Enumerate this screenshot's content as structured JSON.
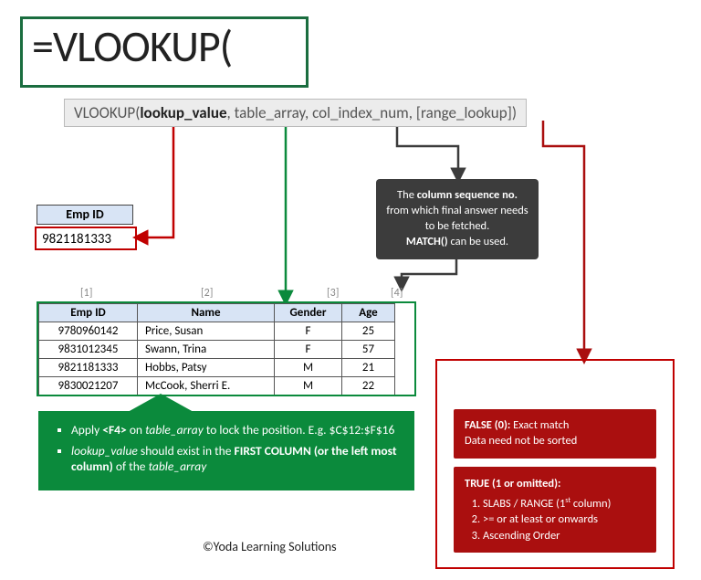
{
  "formula": "=VLOOKUP(",
  "syntax": {
    "fn": "VLOOKUP(",
    "arg1": "lookup_value",
    "sep1": ", ",
    "arg2": "table_array",
    "sep2": ", ",
    "arg3": "col_index_num",
    "sep3": ", ",
    "arg4": "[range_lookup]",
    "close": ")"
  },
  "lookup_cell": {
    "header": "Emp ID",
    "value": "9821181333"
  },
  "column_indices": [
    "[1]",
    "[2]",
    "[3]",
    "[4]"
  ],
  "table": {
    "headers": [
      "Emp ID",
      "Name",
      "Gender",
      "Age"
    ],
    "rows": [
      [
        "9780960142",
        "Price, Susan",
        "F",
        "25"
      ],
      [
        "9831012345",
        "Swann, Trina",
        "F",
        "57"
      ],
      [
        "9821181333",
        "Hobbs, Patsy",
        "M",
        "21"
      ],
      [
        "9830021207",
        "McCook, Sherri E.",
        "M",
        "22"
      ]
    ]
  },
  "green_tip": {
    "item1_pre": "Apply ",
    "item1_key": "<F4>",
    "item1_mid": " on ",
    "item1_it": "table_array",
    "item1_post": " to lock the position. E.g.  $C$12:$F$16",
    "item2_it1": "lookup_value",
    "item2_mid": " should exist in the ",
    "item2_b": "FIRST COLUMN (or the left most column)",
    "item2_post": " of the ",
    "item2_it2": "table_array"
  },
  "grey_callout": {
    "l1a": "The ",
    "l1b": "column sequence no.",
    "l2": "from which final answer needs to be fetched.",
    "l3a": "MATCH()",
    "l3b": " can be used."
  },
  "red_false": {
    "title": "FALSE (0):",
    "desc": " Exact match",
    "line2": "Data need not be sorted"
  },
  "red_true": {
    "title": "TRUE (1 or omitted):",
    "item1a": "SLABS / RANGE (1",
    "item1sup": "st",
    "item1b": " column)",
    "item2": ">= or at least or onwards",
    "item3": "Ascending Order"
  },
  "footer": "©Yoda Learning Solutions"
}
